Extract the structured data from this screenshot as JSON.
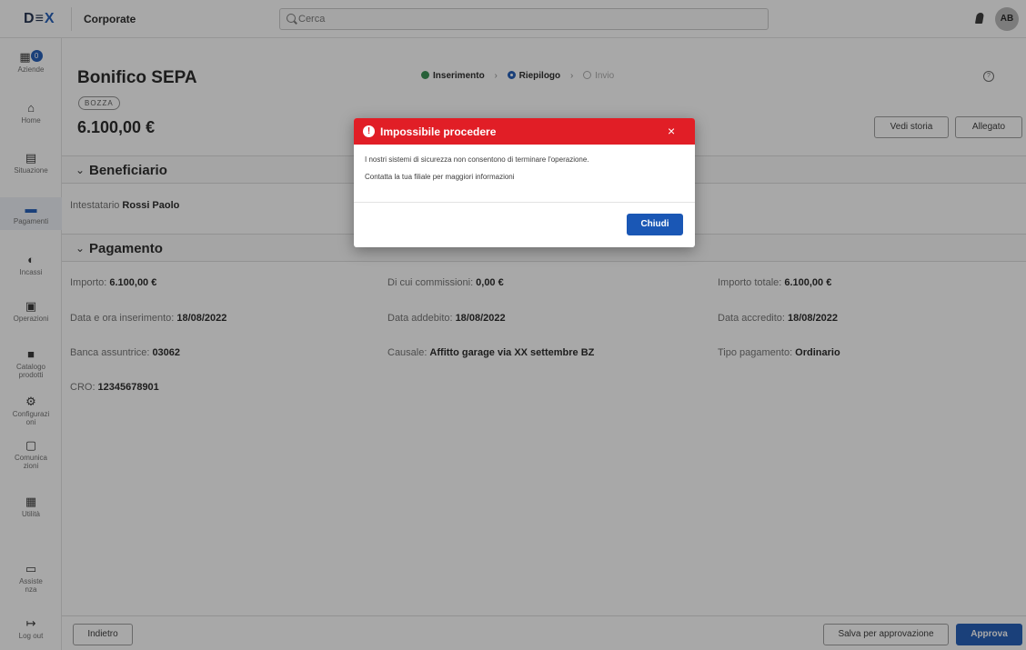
{
  "topbar": {
    "logo_left": "D",
    "logo_mid": "≡",
    "logo_x": "X",
    "company": "Corporate",
    "search_placeholder": "Cerca",
    "avatar_initials": "AB"
  },
  "sidebar": {
    "items": [
      {
        "label": "Aziende",
        "icon": "building-icon",
        "glyph": "▦",
        "badge": "0"
      },
      {
        "label": "Home",
        "icon": "home-icon",
        "glyph": "⌂"
      },
      {
        "label": "Situazione",
        "icon": "report-icon",
        "glyph": "▤"
      },
      {
        "label": "Pagamenti",
        "icon": "payment-icon",
        "glyph": "▬",
        "active": true
      },
      {
        "label": "Incassi",
        "icon": "collection-icon",
        "glyph": "◐"
      },
      {
        "label": "Operazioni",
        "icon": "operations-icon",
        "glyph": "▣"
      },
      {
        "label": "Catalogo prodotti",
        "label2": "prodotti",
        "label1": "Catalogo",
        "icon": "catalog-icon",
        "glyph": "■"
      },
      {
        "label1": "Configurazi",
        "label2": "oni",
        "icon": "settings-icon",
        "glyph": "⚙"
      },
      {
        "label1": "Comunica",
        "label2": "zioni",
        "icon": "message-icon",
        "glyph": "▢"
      },
      {
        "label": "Utilità",
        "icon": "grid-icon",
        "glyph": "▦"
      },
      {
        "label1": "Assiste",
        "label2": "nza",
        "icon": "chat-icon",
        "glyph": "▭"
      },
      {
        "label": "Log out",
        "icon": "logout-icon",
        "glyph": "↦"
      }
    ]
  },
  "header": {
    "title": "Bonifico SEPA",
    "status": "BOZZA",
    "amount": "6.100,00 €",
    "steps": [
      {
        "label": "Inserimento",
        "state": "done"
      },
      {
        "label": "Riepilogo",
        "state": "current"
      },
      {
        "label": "Invio",
        "state": "todo"
      }
    ],
    "step_separator": "›",
    "buttons": {
      "history": "Vedi storia",
      "attachment": "Allegato"
    }
  },
  "beneficiario": {
    "title": "Beneficiario",
    "holder_label": "Intestatario",
    "holder_value": "Rossi Paolo"
  },
  "pagamento": {
    "title": "Pagamento",
    "fields": [
      {
        "label": "Importo:",
        "value": "6.100,00 €"
      },
      {
        "label": "Di cui commissioni:",
        "value": "0,00 €"
      },
      {
        "label": "Importo totale:",
        "value": "6.100,00 €"
      },
      {
        "label": "Data e ora inserimento:",
        "value": "18/08/2022"
      },
      {
        "label": "Data addebito:",
        "value": "18/08/2022"
      },
      {
        "label": "Data accredito:",
        "value": "18/08/2022"
      },
      {
        "label": "Banca assuntrice:",
        "value": "03062"
      },
      {
        "label": "Causale:",
        "value": "Affitto garage via XX settembre BZ"
      },
      {
        "label": "Tipo pagamento:",
        "value": "Ordinario"
      },
      {
        "label": "CRO:",
        "value": "12345678901"
      }
    ]
  },
  "footer": {
    "back": "Indietro",
    "save": "Salva per approvazione",
    "approve": "Approva"
  },
  "modal": {
    "title": "Impossibile procedere",
    "line1": "I nostri sistemi di sicurezza non consentono di terminare l'operazione.",
    "line2": "Contatta la tua filiale per maggiori informazioni",
    "close_button": "Chiudi",
    "close_glyph": "×"
  },
  "colors": {
    "accent": "#1a57b5",
    "error": "#e11e26",
    "success": "#2e8b4b"
  }
}
